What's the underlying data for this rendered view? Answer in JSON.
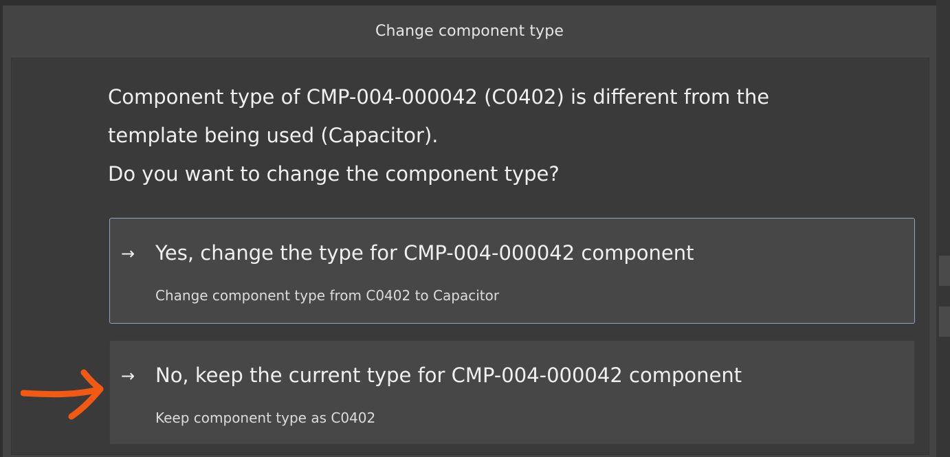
{
  "dialog": {
    "title": "Change component type",
    "message_lines": [
      "Component type of CMP-004-000042 (C0402) is different from the",
      "template being used (Capacitor).",
      "Do you want to change the component type?"
    ]
  },
  "options": [
    {
      "arrow": "→",
      "title": "Yes, change the type for CMP-004-000042 component",
      "subtitle": "Change component type from C0402 to Capacitor",
      "selected": true
    },
    {
      "arrow": "→",
      "title": "No, keep the current type for CMP-004-000042 component",
      "subtitle": "Keep component type as C0402",
      "selected": false
    }
  ],
  "annotation": {
    "icon": "orange-arrow-icon",
    "color": "#f25a14"
  },
  "colors": {
    "dialog_bg": "#444444",
    "content_bg": "#3a3a3a",
    "option_bg": "#474747",
    "selected_border": "#8ea6c0"
  }
}
